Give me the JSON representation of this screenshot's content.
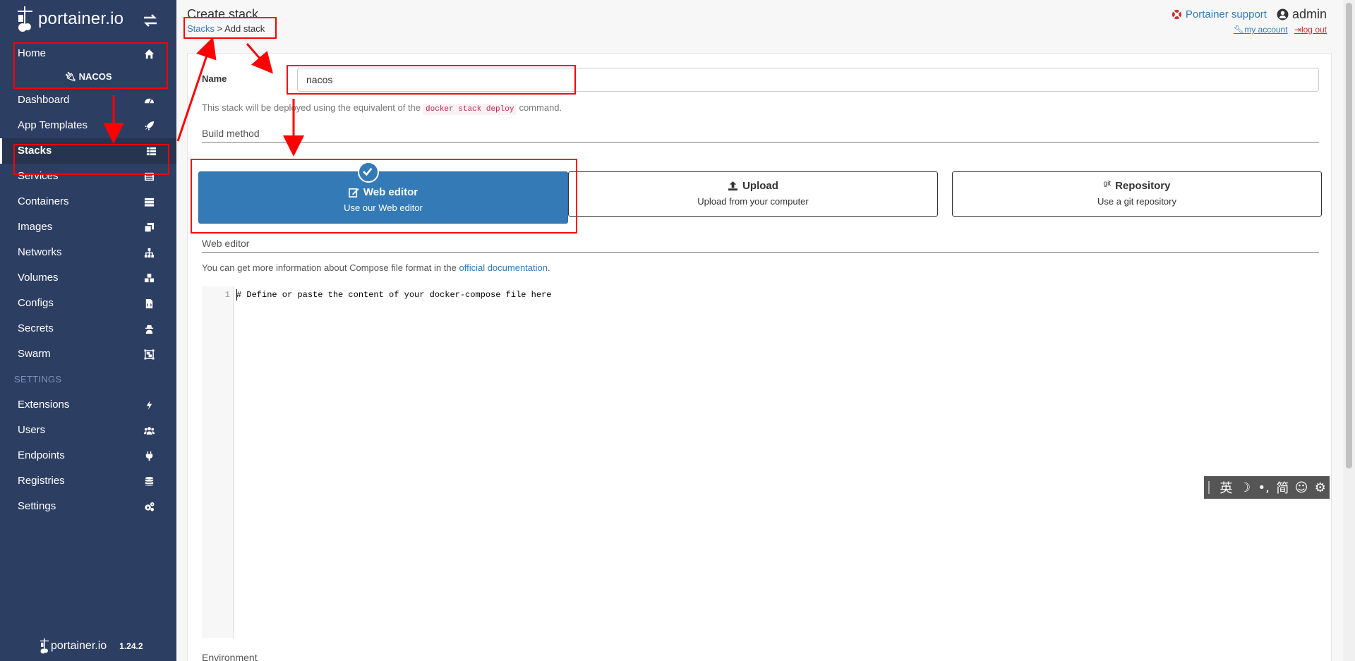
{
  "sidebar": {
    "brand": "portainer.io",
    "nav_top": [
      {
        "label": "Home",
        "icon": "home-icon"
      }
    ],
    "endpoint": "NACOS",
    "nav_endpoint": [
      {
        "label": "Dashboard",
        "icon": "tachometer-icon"
      },
      {
        "label": "App Templates",
        "icon": "rocket-icon"
      },
      {
        "label": "Stacks",
        "icon": "th-list-icon",
        "active": true
      },
      {
        "label": "Services",
        "icon": "list-alt-icon"
      },
      {
        "label": "Containers",
        "icon": "server-icon"
      },
      {
        "label": "Images",
        "icon": "clone-icon"
      },
      {
        "label": "Networks",
        "icon": "sitemap-icon"
      },
      {
        "label": "Volumes",
        "icon": "cubes-icon"
      },
      {
        "label": "Configs",
        "icon": "file-code-icon"
      },
      {
        "label": "Secrets",
        "icon": "user-secret-icon"
      },
      {
        "label": "Swarm",
        "icon": "object-group-icon"
      }
    ],
    "settings_header": "SETTINGS",
    "nav_settings": [
      {
        "label": "Extensions",
        "icon": "bolt-icon"
      },
      {
        "label": "Users",
        "icon": "users-icon"
      },
      {
        "label": "Endpoints",
        "icon": "plug-icon"
      },
      {
        "label": "Registries",
        "icon": "database-icon"
      },
      {
        "label": "Settings",
        "icon": "cogs-icon"
      }
    ],
    "footer_brand": "portainer.io",
    "version": "1.24.2"
  },
  "header": {
    "title": "Create stack",
    "breadcrumb_link": "Stacks",
    "breadcrumb_sep": " > ",
    "breadcrumb_current": "Add stack",
    "support": "Portainer support",
    "user": "admin",
    "my_account": "my account",
    "log_out": "log out"
  },
  "form": {
    "name_label": "Name",
    "name_value": "nacos",
    "help_prefix": "This stack will be deployed using the equivalent of the",
    "help_code": "docker stack deploy",
    "help_suffix": "command.",
    "build_method_title": "Build method",
    "build_methods": [
      {
        "title": "Web editor",
        "desc": "Use our Web editor",
        "selected": true
      },
      {
        "title": "Upload",
        "desc": "Upload from your computer"
      },
      {
        "title": "Repository",
        "desc": "Use a git repository",
        "prefix": "git"
      }
    ],
    "web_editor_title": "Web editor",
    "info_prefix": "You can get more information about Compose file format in the",
    "info_link": "official documentation",
    "info_suffix": ".",
    "editor_line_no": "1",
    "editor_content": "# Define or paste the content of your docker-compose file here",
    "environment_title": "Environment"
  },
  "ime": {
    "items": [
      "英",
      "☽",
      "•,",
      "简",
      "☺",
      "⚙"
    ]
  },
  "colors": {
    "sidebar_bg": "#2d3e63",
    "accent": "#337ab7",
    "annotation": "#ff0000"
  }
}
